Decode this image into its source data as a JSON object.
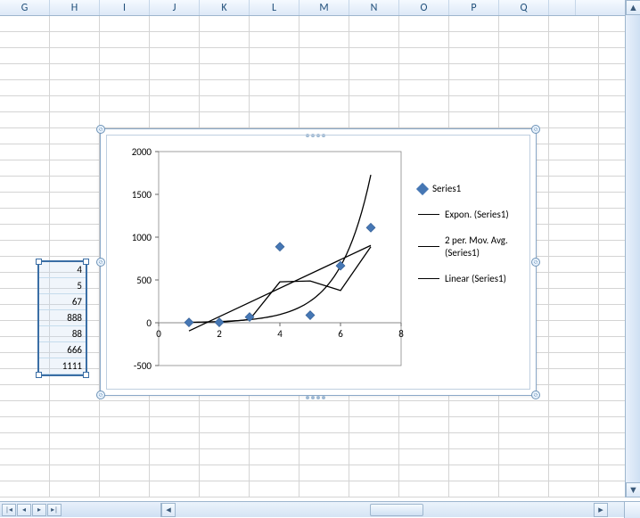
{
  "columns": [
    "G",
    "H",
    "I",
    "J",
    "K",
    "L",
    "M",
    "N",
    "O",
    "P",
    "Q"
  ],
  "cell_values": [
    "4",
    "5",
    "67",
    "888",
    "88",
    "666",
    "1111"
  ],
  "legend": {
    "series": "Series1",
    "expon": "Expon. (Series1)",
    "movavg": "2 per. Mov. Avg. (Series1)",
    "linear": "Linear (Series1)"
  },
  "chart_data": {
    "type": "scatter",
    "x": [
      1,
      2,
      3,
      4,
      5,
      6,
      7
    ],
    "series": [
      {
        "name": "Series1",
        "values": [
          4,
          5,
          67,
          888,
          88,
          666,
          1111
        ],
        "style": "points"
      }
    ],
    "trendlines": [
      {
        "name": "Expon. (Series1)",
        "type": "exponential"
      },
      {
        "name": "2 per. Mov. Avg. (Series1)",
        "type": "moving_average",
        "period": 2
      },
      {
        "name": "Linear (Series1)",
        "type": "linear"
      }
    ],
    "xlim": [
      0,
      8
    ],
    "ylim": [
      -500,
      2000
    ],
    "xticks": [
      0,
      2,
      4,
      6,
      8
    ],
    "yticks": [
      -500,
      0,
      500,
      1000,
      1500,
      2000
    ],
    "xlabel": "",
    "ylabel": "",
    "title": "",
    "grid": false,
    "legend_position": "right"
  }
}
